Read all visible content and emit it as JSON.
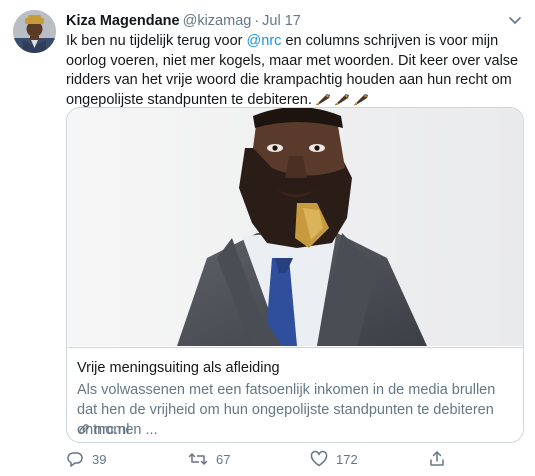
{
  "tweet": {
    "author_name": "Kiza Magendane",
    "handle": "@kizamag",
    "separator": "·",
    "date": "Jul 17",
    "text_before_mention": "Ik ben nu tijdelijk terug voor ",
    "mention": "@nrc",
    "text_after_mention": " en columns schrijven is voor mijn oorlog voeren, niet mer kogels, maar met woorden. Dit keer over valse ridders van het vrije woord die krampachtig houden aan hun recht om ongepolijste standpunten te debiteren.",
    "emoji": [
      "fountain-pen",
      "fountain-pen",
      "fountain-pen"
    ]
  },
  "card": {
    "title": "Vrije meningsuiting als afleiding",
    "description": "Als volwassenen met een fatsoenlijk inkomen in de media brullen dat hen de vrijheid om hun ongepolijste standpunten te debiteren ontnomen ...",
    "domain": "nrc.nl",
    "image_icon": "portrait-photo"
  },
  "actions": {
    "reply_count": "39",
    "retweet_count": "67",
    "like_count": "172"
  },
  "colors": {
    "link": "#1b95e0",
    "muted": "#657786",
    "text": "#14171a",
    "border": "#ccd6dd"
  }
}
